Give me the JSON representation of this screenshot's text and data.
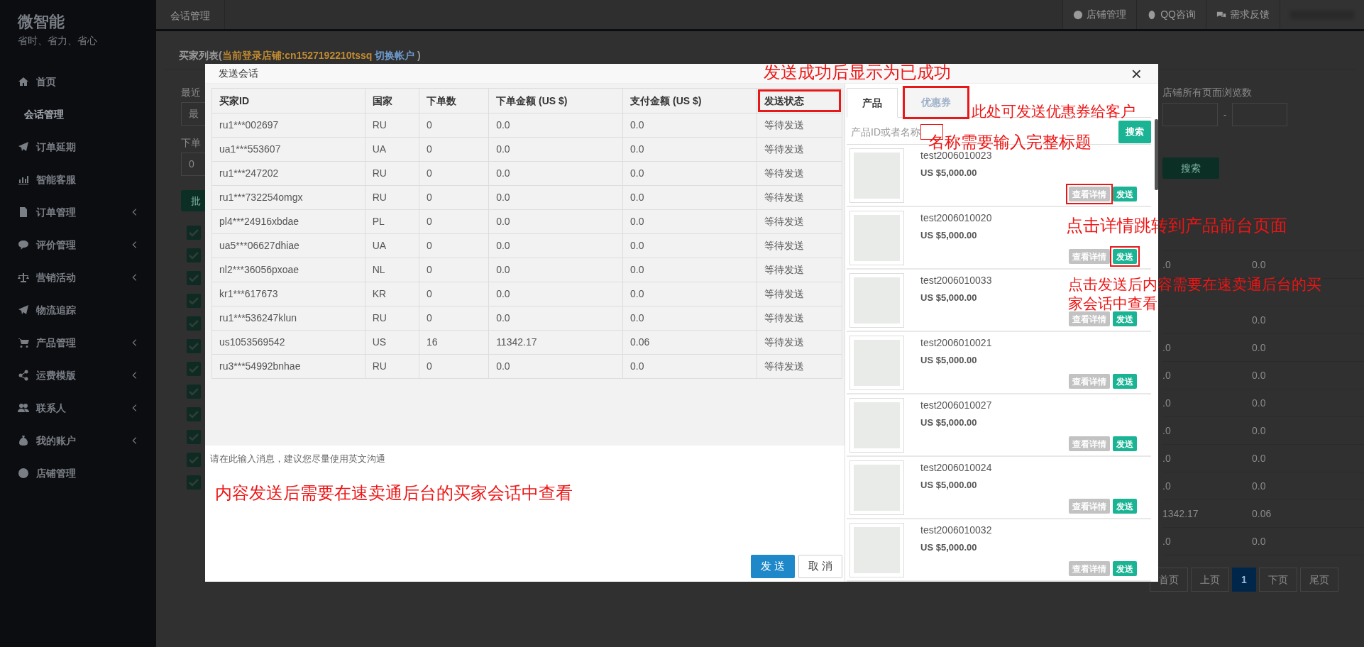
{
  "sidebar": {
    "brand": "微智能",
    "slogan": "省时、省力、省心",
    "items": [
      {
        "label": "首页",
        "selected": false,
        "expandable": false
      },
      {
        "label": "会话管理",
        "selected": true,
        "expandable": false
      },
      {
        "label": "订单延期",
        "selected": false,
        "expandable": false
      },
      {
        "label": "智能客服",
        "selected": false,
        "expandable": false
      },
      {
        "label": "订单管理",
        "selected": false,
        "expandable": true
      },
      {
        "label": "评价管理",
        "selected": false,
        "expandable": true
      },
      {
        "label": "营销活动",
        "selected": false,
        "expandable": true
      },
      {
        "label": "物流追踪",
        "selected": false,
        "expandable": false
      },
      {
        "label": "产品管理",
        "selected": false,
        "expandable": true
      },
      {
        "label": "运费模版",
        "selected": false,
        "expandable": true
      },
      {
        "label": "联系人",
        "selected": false,
        "expandable": true
      },
      {
        "label": "我的账户",
        "selected": false,
        "expandable": true
      },
      {
        "label": "店铺管理",
        "selected": false,
        "expandable": false
      }
    ]
  },
  "topbar": {
    "title": "会话管理",
    "links": [
      {
        "label": "店铺管理"
      },
      {
        "label": "QQ咨询"
      },
      {
        "label": "需求反馈"
      }
    ]
  },
  "page": {
    "heading": {
      "prefix": "买家列表(",
      "store": "当前登录店铺:cn1527192210tssq",
      "link": "切换帐户",
      "suffix": " )"
    },
    "left_filters": [
      {
        "label": "最近",
        "value": "最"
      },
      {
        "label": "下单",
        "value": "0"
      }
    ],
    "batch_button": "批",
    "row_checks": [
      {
        "checked": true
      },
      {
        "checked": true
      },
      {
        "checked": true
      },
      {
        "checked": true
      },
      {
        "checked": true
      },
      {
        "checked": true
      },
      {
        "checked": true
      },
      {
        "checked": true
      },
      {
        "checked": true
      },
      {
        "checked": true
      },
      {
        "checked": true
      },
      {
        "checked": true
      }
    ],
    "views_label": "店铺所有页面浏览数",
    "range_separator": "-",
    "search_button": "搜索",
    "table": {
      "rows": [
        {
          "column_1": ".0",
          "column_2": "0.0"
        },
        {},
        {
          "column_2": "0.0"
        },
        {
          "column_1": ".0",
          "column_2": "0.0"
        },
        {
          "column_1": ".0",
          "column_2": "0.0"
        },
        {
          "column_1": ".0",
          "column_2": "0.0"
        },
        {
          "column_1": ".0",
          "column_2": "0.0"
        },
        {
          "column_1": ".0",
          "column_2": "0.0"
        },
        {
          "column_1": ".0",
          "column_2": "0.0"
        },
        {
          "column_1": "1342.17",
          "column_2": "0.06"
        },
        {
          "column_1": ".0",
          "column_2": "0.0"
        }
      ]
    },
    "pagination": [
      {
        "label": "首页",
        "selected": false
      },
      {
        "label": "上页",
        "selected": false
      },
      {
        "label": "1",
        "selected": true
      },
      {
        "label": "下页",
        "selected": false
      },
      {
        "label": "尾页",
        "selected": false
      }
    ]
  },
  "modal": {
    "title": "发送会话",
    "close": "×",
    "columns": [
      {
        "label": "买家ID",
        "highlighted": false
      },
      {
        "label": "国家",
        "highlighted": false
      },
      {
        "label": "下单数",
        "highlighted": false
      },
      {
        "label": "下单金额 (US $)",
        "highlighted": false
      },
      {
        "label": "支付金额 (US $)",
        "highlighted": false
      },
      {
        "label": "发送状态",
        "highlighted": true
      }
    ],
    "rows": [
      [
        "ru1***002697",
        "RU",
        "0",
        "0.0",
        "0.0",
        "等待发送"
      ],
      [
        "ua1***553607",
        "UA",
        "0",
        "0.0",
        "0.0",
        "等待发送"
      ],
      [
        "ru1***247202",
        "RU",
        "0",
        "0.0",
        "0.0",
        "等待发送"
      ],
      [
        "ru1***732254omgx",
        "RU",
        "0",
        "0.0",
        "0.0",
        "等待发送"
      ],
      [
        "pl4***24916xbdae",
        "PL",
        "0",
        "0.0",
        "0.0",
        "等待发送"
      ],
      [
        "ua5***06627dhiae",
        "UA",
        "0",
        "0.0",
        "0.0",
        "等待发送"
      ],
      [
        "nl2***36056pxoae",
        "NL",
        "0",
        "0.0",
        "0.0",
        "等待发送"
      ],
      [
        "kr1***617673",
        "KR",
        "0",
        "0.0",
        "0.0",
        "等待发送"
      ],
      [
        "ru1***536247klun",
        "RU",
        "0",
        "0.0",
        "0.0",
        "等待发送"
      ],
      [
        "us1053569542",
        "US",
        "16",
        "11342.17",
        "0.06",
        "等待发送"
      ],
      [
        "ru3***54992bnhae",
        "RU",
        "0",
        "0.0",
        "0.0",
        "等待发送"
      ]
    ],
    "message_placeholder": "请在此输入消息，建议您尽量使用英文沟通",
    "send_button": "发 送",
    "cancel_button": "取 消",
    "tabs": [
      {
        "label": "产品",
        "selected": true,
        "highlighted": false
      },
      {
        "label": "优惠券",
        "selected": false,
        "highlighted": true
      }
    ],
    "search": {
      "placeholder": "产品ID或者名称",
      "highlighted": true,
      "button": "搜索"
    },
    "products": [
      {
        "name": "test2006010023",
        "price": "US $5,000.00",
        "details_button": "查看详情",
        "send_button": "发送",
        "details_highlighted": true,
        "send_highlighted": false
      },
      {
        "name": "test2006010020",
        "price": "US $5,000.00",
        "details_button": "查看详情",
        "send_button": "发送",
        "details_highlighted": false,
        "send_highlighted": true
      },
      {
        "name": "test2006010033",
        "price": "US $5,000.00",
        "details_button": "查看详情",
        "send_button": "发送",
        "details_highlighted": false,
        "send_highlighted": false
      },
      {
        "name": "test2006010021",
        "price": "US $5,000.00",
        "details_button": "查看详情",
        "send_button": "发送",
        "details_highlighted": false,
        "send_highlighted": false
      },
      {
        "name": "test2006010027",
        "price": "US $5,000.00",
        "details_button": "查看详情",
        "send_button": "发送",
        "details_highlighted": false,
        "send_highlighted": false
      },
      {
        "name": "test2006010024",
        "price": "US $5,000.00",
        "details_button": "查看详情",
        "send_button": "发送",
        "details_highlighted": false,
        "send_highlighted": false
      },
      {
        "name": "test2006010032",
        "price": "US $5,000.00",
        "details_button": "查看详情",
        "send_button": "发送",
        "details_highlighted": false,
        "send_highlighted": false
      }
    ]
  },
  "annotations": [
    {
      "text": "发送成功后显示为已成功"
    },
    {
      "text": "此处可发送优惠券给客户"
    },
    {
      "text": "名称需要输入完整标题"
    },
    {
      "text": "点击详情跳转到产品前台页面"
    },
    {
      "text": "点击发送后内容需要在速卖通后台的买家会话中查看"
    },
    {
      "text": "内容发送后需要在速卖通后台的买家会话中查看"
    }
  ]
}
